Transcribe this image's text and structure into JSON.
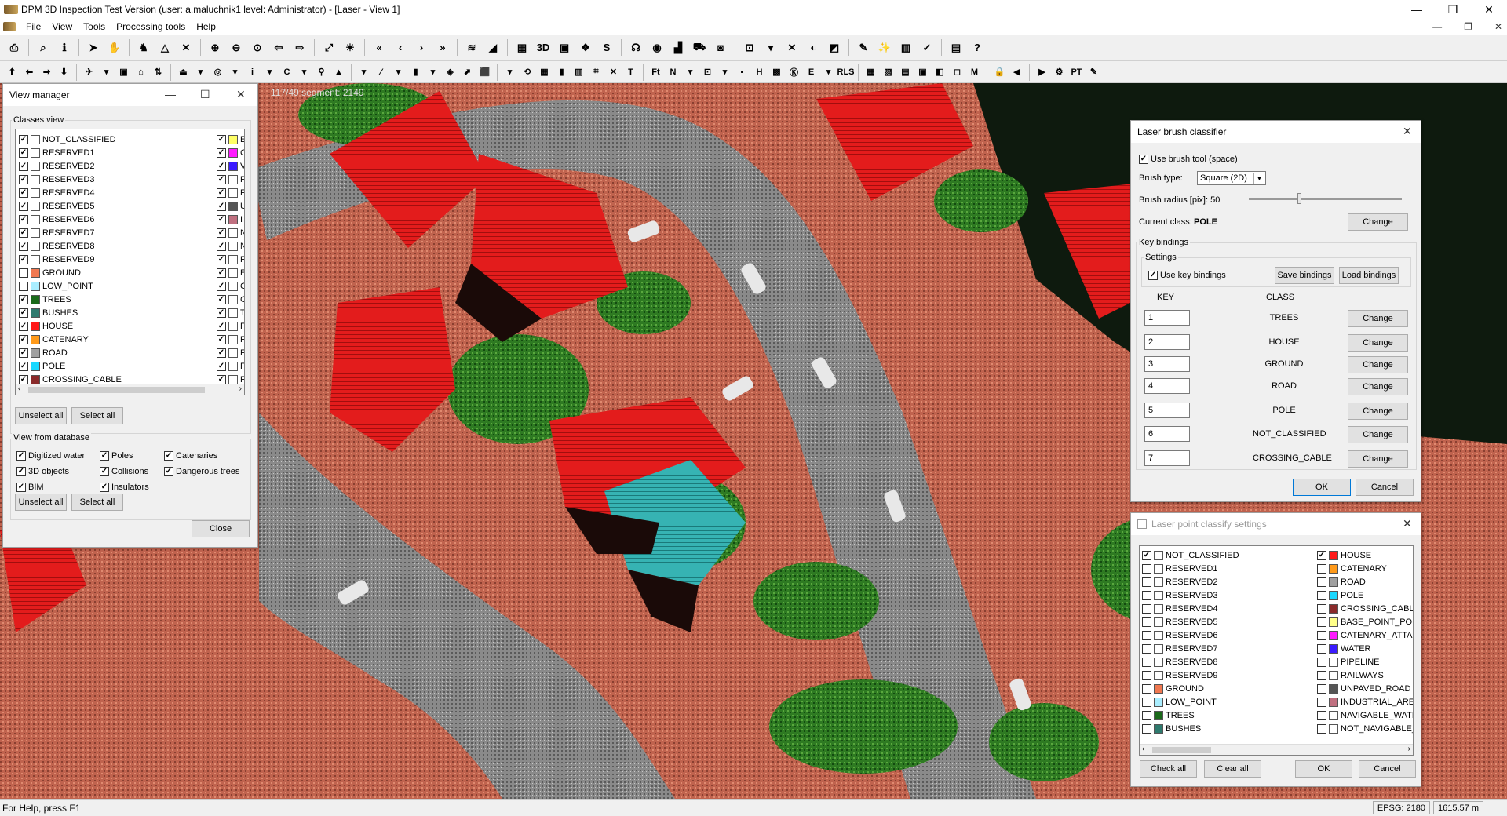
{
  "window": {
    "title": "DPM 3D Inspection Test Version (user: a.maluchnik1 level: Administrator) - [Laser - View 1]",
    "minimize": "—",
    "maximize": "❐",
    "close": "✕"
  },
  "menu": {
    "items": [
      "File",
      "View",
      "Tools",
      "Processing tools",
      "Help"
    ],
    "mdi_minimize": "—",
    "mdi_restore": "❐",
    "mdi_close": "✕"
  },
  "toolbar1": [
    "⎙",
    "⌕",
    "ℹ",
    "➤",
    "✋",
    "♞",
    "△",
    "✕",
    "⊕",
    "⊖",
    "⊙",
    "⇦",
    "⇨",
    "⤢",
    "☀",
    "«",
    "‹",
    "›",
    "»",
    "≋",
    "◢",
    "▦",
    "3D",
    "▣",
    "❖",
    "S",
    "☊",
    "◉",
    "▟",
    "⛟",
    "◙",
    "⊡",
    "▾",
    "✕",
    "◐",
    "◩",
    "✎",
    "✨",
    "▥",
    "✓",
    "▤",
    "?"
  ],
  "toolbar2": [
    "⬆",
    "⬅",
    "➡",
    "⬇",
    "✈",
    "▾",
    "▣",
    "⌂",
    "⇅",
    "⏏",
    "▾",
    "◎",
    "▾",
    "i",
    "▾",
    "C",
    "▾",
    "⚲",
    "▲",
    "▾",
    "⁄",
    "▾",
    "▮",
    "▾",
    "◈",
    "⬈",
    "⬛",
    "▾",
    "⟲",
    "▦",
    "▮",
    "▥",
    "⌗",
    "✕",
    "T",
    "Ft",
    "N",
    "▾",
    "⊡",
    "▾",
    "▪",
    "H",
    "▩",
    "Ⓚ",
    "E",
    "▾",
    "RLS",
    "▦",
    "▧",
    "▤",
    "▣",
    "◧",
    "◻",
    "M",
    "🔒",
    "◀",
    "▶",
    "⚙",
    "PT",
    "✎"
  ],
  "viewport": {
    "overlay_text": "117/49 segment: 2149"
  },
  "status": {
    "help": "For Help, press F1",
    "field1": "EPSG: 2180",
    "field2": "1615.57 m"
  },
  "view_manager": {
    "title": "View manager",
    "classes_label": "Classes view",
    "classes_left": [
      {
        "name": "NOT_CLASSIFIED",
        "checked": true,
        "color": "#ffffff"
      },
      {
        "name": "RESERVED1",
        "checked": true,
        "color": "#ffffff"
      },
      {
        "name": "RESERVED2",
        "checked": true,
        "color": "#ffffff"
      },
      {
        "name": "RESERVED3",
        "checked": true,
        "color": "#ffffff"
      },
      {
        "name": "RESERVED4",
        "checked": true,
        "color": "#ffffff"
      },
      {
        "name": "RESERVED5",
        "checked": true,
        "color": "#ffffff"
      },
      {
        "name": "RESERVED6",
        "checked": true,
        "color": "#ffffff"
      },
      {
        "name": "RESERVED7",
        "checked": true,
        "color": "#ffffff"
      },
      {
        "name": "RESERVED8",
        "checked": true,
        "color": "#ffffff"
      },
      {
        "name": "RESERVED9",
        "checked": true,
        "color": "#ffffff"
      },
      {
        "name": "GROUND",
        "checked": false,
        "color": "#f07850"
      },
      {
        "name": "LOW_POINT",
        "checked": false,
        "color": "#aaeeff"
      },
      {
        "name": "TREES",
        "checked": true,
        "color": "#1a6a1a"
      },
      {
        "name": "BUSHES",
        "checked": true,
        "color": "#2e7a6e"
      },
      {
        "name": "HOUSE",
        "checked": true,
        "color": "#ff1a1a"
      },
      {
        "name": "CATENARY",
        "checked": true,
        "color": "#ff9a1a"
      },
      {
        "name": "ROAD",
        "checked": true,
        "color": "#a0a0a0"
      },
      {
        "name": "POLE",
        "checked": true,
        "color": "#1ad8ff"
      },
      {
        "name": "CROSSING_CABLE",
        "checked": true,
        "color": "#8a2a2a"
      }
    ],
    "classes_right": [
      {
        "name": "E",
        "checked": true,
        "color": "#ffff66"
      },
      {
        "name": "C",
        "checked": true,
        "color": "#ff1aff"
      },
      {
        "name": "V",
        "checked": true,
        "color": "#3a1aff"
      },
      {
        "name": "P",
        "checked": true,
        "color": "#ffffff"
      },
      {
        "name": "F",
        "checked": true,
        "color": "#ffffff"
      },
      {
        "name": "U",
        "checked": true,
        "color": "#555555"
      },
      {
        "name": "I",
        "checked": true,
        "color": "#c07080"
      },
      {
        "name": "N",
        "checked": true,
        "color": "#ffffff"
      },
      {
        "name": "N",
        "checked": true,
        "color": "#ffffff"
      },
      {
        "name": "F",
        "checked": true,
        "color": "#ffffff"
      },
      {
        "name": "E",
        "checked": true,
        "color": "#ffffff"
      },
      {
        "name": "C",
        "checked": true,
        "color": "#ffffff"
      },
      {
        "name": "C",
        "checked": true,
        "color": "#ffffff"
      },
      {
        "name": "T",
        "checked": true,
        "color": "#ffffff"
      },
      {
        "name": "F",
        "checked": true,
        "color": "#ffffff"
      },
      {
        "name": "F",
        "checked": true,
        "color": "#ffffff"
      },
      {
        "name": "F",
        "checked": true,
        "color": "#ffffff"
      },
      {
        "name": "F",
        "checked": true,
        "color": "#ffffff"
      },
      {
        "name": "F",
        "checked": true,
        "color": "#ffffff"
      }
    ],
    "unselect_all": "Unselect all",
    "select_all": "Select all",
    "db_label": "View from database",
    "db_col1": [
      {
        "name": "Digitized water",
        "checked": true
      },
      {
        "name": "3D objects",
        "checked": true
      },
      {
        "name": "BIM",
        "checked": true
      }
    ],
    "db_col2": [
      {
        "name": "Poles",
        "checked": true
      },
      {
        "name": "Collisions",
        "checked": true
      },
      {
        "name": "Insulators",
        "checked": true
      }
    ],
    "db_col3": [
      {
        "name": "Catenaries",
        "checked": true
      },
      {
        "name": "Dangerous trees",
        "checked": true
      }
    ],
    "unselect_all_2": "Unselect all",
    "select_all_2": "Select all",
    "close": "Close",
    "minimize": "—",
    "maximize": "☐",
    "close_x": "✕",
    "scroll_left": "‹",
    "scroll_right": "›"
  },
  "brush": {
    "title": "Laser brush classifier",
    "close_x": "✕",
    "use_brush": "Use brush tool (space)",
    "use_brush_checked": true,
    "brush_type_label": "Brush type:",
    "brush_type_value": "Square (2D)",
    "dd_arrow": "▼",
    "radius_label": "Brush radius [pix]: 50",
    "radius_level": 0.32,
    "current_class_label": "Current class:",
    "current_class_value": "POLE",
    "change": "Change",
    "key_bindings_label": "Key bindings",
    "settings_label": "Settings",
    "use_key_bindings": "Use key bindings",
    "use_key_bindings_checked": true,
    "save_bindings": "Save bindings",
    "load_bindings": "Load bindings",
    "key_header": "KEY",
    "class_header": "CLASS",
    "bindings": [
      {
        "key": "1",
        "cls": "TREES",
        "btn": "Change"
      },
      {
        "key": "2",
        "cls": "HOUSE",
        "btn": "Change"
      },
      {
        "key": "3",
        "cls": "GROUND",
        "btn": "Change"
      },
      {
        "key": "4",
        "cls": "ROAD",
        "btn": "Change"
      },
      {
        "key": "5",
        "cls": "POLE",
        "btn": "Change"
      },
      {
        "key": "6",
        "cls": "NOT_CLASSIFIED",
        "btn": "Change"
      },
      {
        "key": "7",
        "cls": "CROSSING_CABLE",
        "btn": "Change"
      }
    ],
    "ok": "OK",
    "cancel": "Cancel"
  },
  "classify": {
    "title": "Laser point classify settings",
    "close_x": "✕",
    "left": [
      {
        "name": "NOT_CLASSIFIED",
        "checked": true,
        "color": "#ffffff"
      },
      {
        "name": "RESERVED1",
        "checked": false,
        "color": "#ffffff"
      },
      {
        "name": "RESERVED2",
        "checked": false,
        "color": "#ffffff"
      },
      {
        "name": "RESERVED3",
        "checked": false,
        "color": "#ffffff"
      },
      {
        "name": "RESERVED4",
        "checked": false,
        "color": "#ffffff"
      },
      {
        "name": "RESERVED5",
        "checked": false,
        "color": "#ffffff"
      },
      {
        "name": "RESERVED6",
        "checked": false,
        "color": "#ffffff"
      },
      {
        "name": "RESERVED7",
        "checked": false,
        "color": "#ffffff"
      },
      {
        "name": "RESERVED8",
        "checked": false,
        "color": "#ffffff"
      },
      {
        "name": "RESERVED9",
        "checked": false,
        "color": "#ffffff"
      },
      {
        "name": "GROUND",
        "checked": false,
        "color": "#f07850"
      },
      {
        "name": "LOW_POINT",
        "checked": false,
        "color": "#aaeeff"
      },
      {
        "name": "TREES",
        "checked": false,
        "color": "#1a6a1a"
      },
      {
        "name": "BUSHES",
        "checked": false,
        "color": "#2e7a6e"
      }
    ],
    "right": [
      {
        "name": "HOUSE",
        "checked": true,
        "color": "#ff1a1a"
      },
      {
        "name": "CATENARY",
        "checked": false,
        "color": "#ff9a1a"
      },
      {
        "name": "ROAD",
        "checked": false,
        "color": "#a0a0a0"
      },
      {
        "name": "POLE",
        "checked": false,
        "color": "#1ad8ff"
      },
      {
        "name": "CROSSING_CABLE",
        "checked": false,
        "color": "#8a2a2a"
      },
      {
        "name": "BASE_POINT_POLE",
        "checked": false,
        "color": "#ffff88"
      },
      {
        "name": "CATENARY_ATTAC",
        "checked": false,
        "color": "#ff1aff"
      },
      {
        "name": "WATER",
        "checked": false,
        "color": "#3a1aff"
      },
      {
        "name": "PIPELINE",
        "checked": false,
        "color": "#ffffff"
      },
      {
        "name": "RAILWAYS",
        "checked": false,
        "color": "#ffffff"
      },
      {
        "name": "UNPAVED_ROAD",
        "checked": false,
        "color": "#555555"
      },
      {
        "name": "INDUSTRIAL_AREA",
        "checked": false,
        "color": "#c07080"
      },
      {
        "name": "NAVIGABLE_WATE",
        "checked": false,
        "color": "#ffffff"
      },
      {
        "name": "NOT_NAVIGABLE_",
        "checked": false,
        "color": "#ffffff"
      }
    ],
    "check_all": "Check all",
    "clear_all": "Clear all",
    "ok": "OK",
    "cancel": "Cancel",
    "scroll_left": "‹",
    "scroll_right": "›"
  }
}
